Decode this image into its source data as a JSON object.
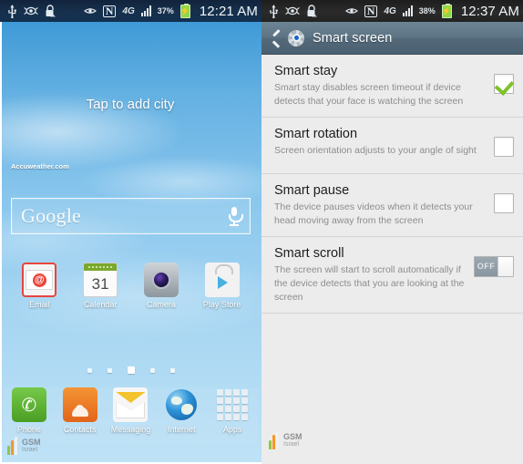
{
  "left_phone": {
    "statusbar": {
      "icons_left": [
        "usb-icon",
        "smart-stay-eye-icon",
        "lock-icon"
      ],
      "eye_icon": "eye-icon",
      "nfc_label": "N",
      "network_label": "4G",
      "battery_percent": "37%",
      "clock": "12:21 AM"
    },
    "weather_widget": {
      "title": "Tap to add city",
      "credit": "Accuweather.com"
    },
    "search": {
      "logo_text": "Google",
      "placeholder": "Google"
    },
    "apps": [
      {
        "label": "Email",
        "icon": "email-icon"
      },
      {
        "label": "Calendar",
        "icon": "calendar-icon",
        "day": "31"
      },
      {
        "label": "Camera",
        "icon": "camera-icon"
      },
      {
        "label": "Play Store",
        "icon": "play-store-icon"
      }
    ],
    "page_indicator": {
      "count": 5,
      "active_index": 2
    },
    "dock": [
      {
        "label": "Phone",
        "icon": "phone-icon"
      },
      {
        "label": "Contacts",
        "icon": "contacts-icon"
      },
      {
        "label": "Messaging",
        "icon": "messaging-icon"
      },
      {
        "label": "Internet",
        "icon": "internet-globe-icon"
      },
      {
        "label": "Apps",
        "icon": "apps-grid-icon"
      }
    ],
    "watermark": {
      "line1": "GSM",
      "line2": "Israel"
    }
  },
  "right_settings": {
    "statusbar": {
      "nfc_label": "N",
      "network_label": "4G",
      "battery_percent": "38%",
      "clock": "12:37 AM"
    },
    "header": {
      "back": "back-chevron-icon",
      "icon": "settings-gear-icon",
      "title": "Smart screen"
    },
    "items": [
      {
        "title": "Smart stay",
        "desc": "Smart stay disables screen timeout if device detects that your face is watching the screen",
        "control": "checkbox",
        "checked": true
      },
      {
        "title": "Smart rotation",
        "desc": "Screen orientation adjusts to your angle of sight",
        "control": "checkbox",
        "checked": false
      },
      {
        "title": "Smart pause",
        "desc": "The device pauses videos when it detects your head moving away from the screen",
        "control": "checkbox",
        "checked": false
      },
      {
        "title": "Smart scroll",
        "desc": "The screen will start to scroll automatically if the device detects that you are looking at the screen",
        "control": "toggle",
        "toggle_label": "OFF",
        "checked": false
      }
    ],
    "watermark": {
      "line1": "GSM",
      "line2": "Israel"
    }
  },
  "colors": {
    "checkbox_check": "#7ec22a",
    "gear_accent": "#1a64c8",
    "header_bg": "#5e7585",
    "list_bg": "#ececec"
  }
}
